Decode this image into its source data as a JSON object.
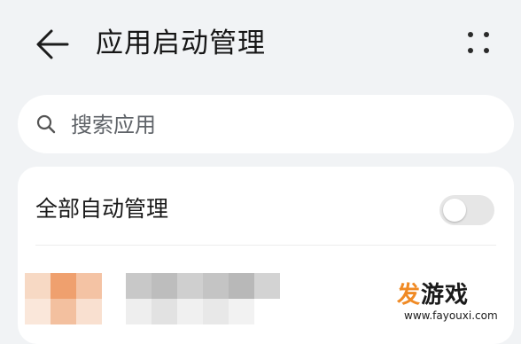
{
  "header": {
    "back_icon": "arrow-left-icon",
    "title": "应用启动管理",
    "more_icon": "more-dots-icon"
  },
  "search": {
    "icon": "search-icon",
    "placeholder": "搜索应用"
  },
  "auto_manage": {
    "label": "全部自动管理",
    "enabled": false
  },
  "colors": {
    "background": "#f1f3f5",
    "card": "#ffffff",
    "toggle_off": "#e6e6e6",
    "watermark_accent": "#f08a24"
  },
  "watermark": {
    "accent_char": "发",
    "main_text": "游戏",
    "url": "www.fayouxi.com"
  }
}
